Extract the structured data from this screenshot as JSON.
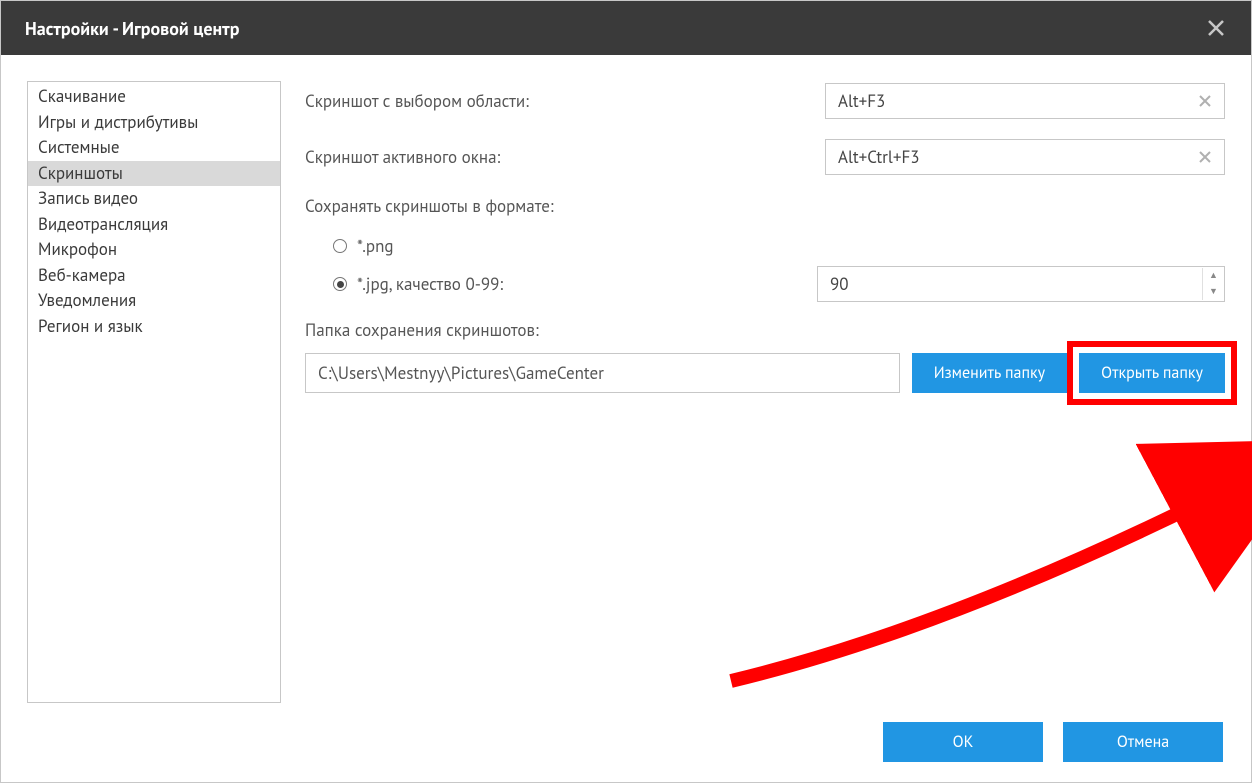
{
  "window": {
    "title": "Настройки - Игровой центр"
  },
  "sidebar": {
    "items": [
      {
        "label": "Скачивание",
        "id": "download"
      },
      {
        "label": "Игры и дистрибутивы",
        "id": "games"
      },
      {
        "label": "Системные",
        "id": "system"
      },
      {
        "label": "Скриншоты",
        "id": "screenshots",
        "selected": true
      },
      {
        "label": "Запись видео",
        "id": "videorecord"
      },
      {
        "label": "Видеотрансляция",
        "id": "stream"
      },
      {
        "label": "Микрофон",
        "id": "mic"
      },
      {
        "label": "Веб-камера",
        "id": "webcam"
      },
      {
        "label": "Уведомления",
        "id": "notifications"
      },
      {
        "label": "Регион и язык",
        "id": "region"
      }
    ]
  },
  "main": {
    "area_screenshot": {
      "label": "Скриншот с выбором области:",
      "value": "Alt+F3"
    },
    "active_window_screenshot": {
      "label": "Скриншот активного окна:",
      "value": "Alt+Ctrl+F3"
    },
    "format": {
      "label": "Сохранять скриншоты в формате:",
      "png_label": "*.png",
      "jpg_label": "*.jpg, качество 0-99:",
      "jpg_quality": "90",
      "selected": "jpg"
    },
    "folder": {
      "label": "Папка сохранения скриншотов:",
      "value": "C:\\Users\\Mestnyy\\Pictures\\GameCenter",
      "change_button": "Изменить папку",
      "open_button": "Открыть папку"
    }
  },
  "footer": {
    "ok": "OK",
    "cancel": "Отмена"
  }
}
